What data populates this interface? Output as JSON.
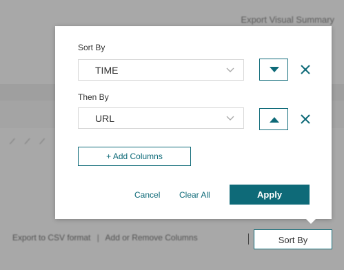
{
  "background": {
    "export_visual_summary": "Export Visual Summary",
    "export_csv": "Export to CSV format",
    "add_remove_columns": "Add or Remove Columns",
    "separator": "|",
    "sort_by_button": "Sort By"
  },
  "sort_panel": {
    "sort_by_label": "Sort By",
    "sort_by_value": "TIME",
    "sort_by_direction": "descending",
    "then_by_label": "Then By",
    "then_by_value": "URL",
    "then_by_direction": "ascending",
    "add_columns_label": "+ Add Columns",
    "cancel_label": "Cancel",
    "clear_all_label": "Clear All",
    "apply_label": "Apply"
  },
  "colors": {
    "accent": "#0e6a78",
    "overlay": "#a9a9a9"
  },
  "icons": {
    "chevron": "chevron-down-icon",
    "sort_desc": "caret-down-icon",
    "sort_asc": "caret-up-icon",
    "remove": "close-icon"
  }
}
